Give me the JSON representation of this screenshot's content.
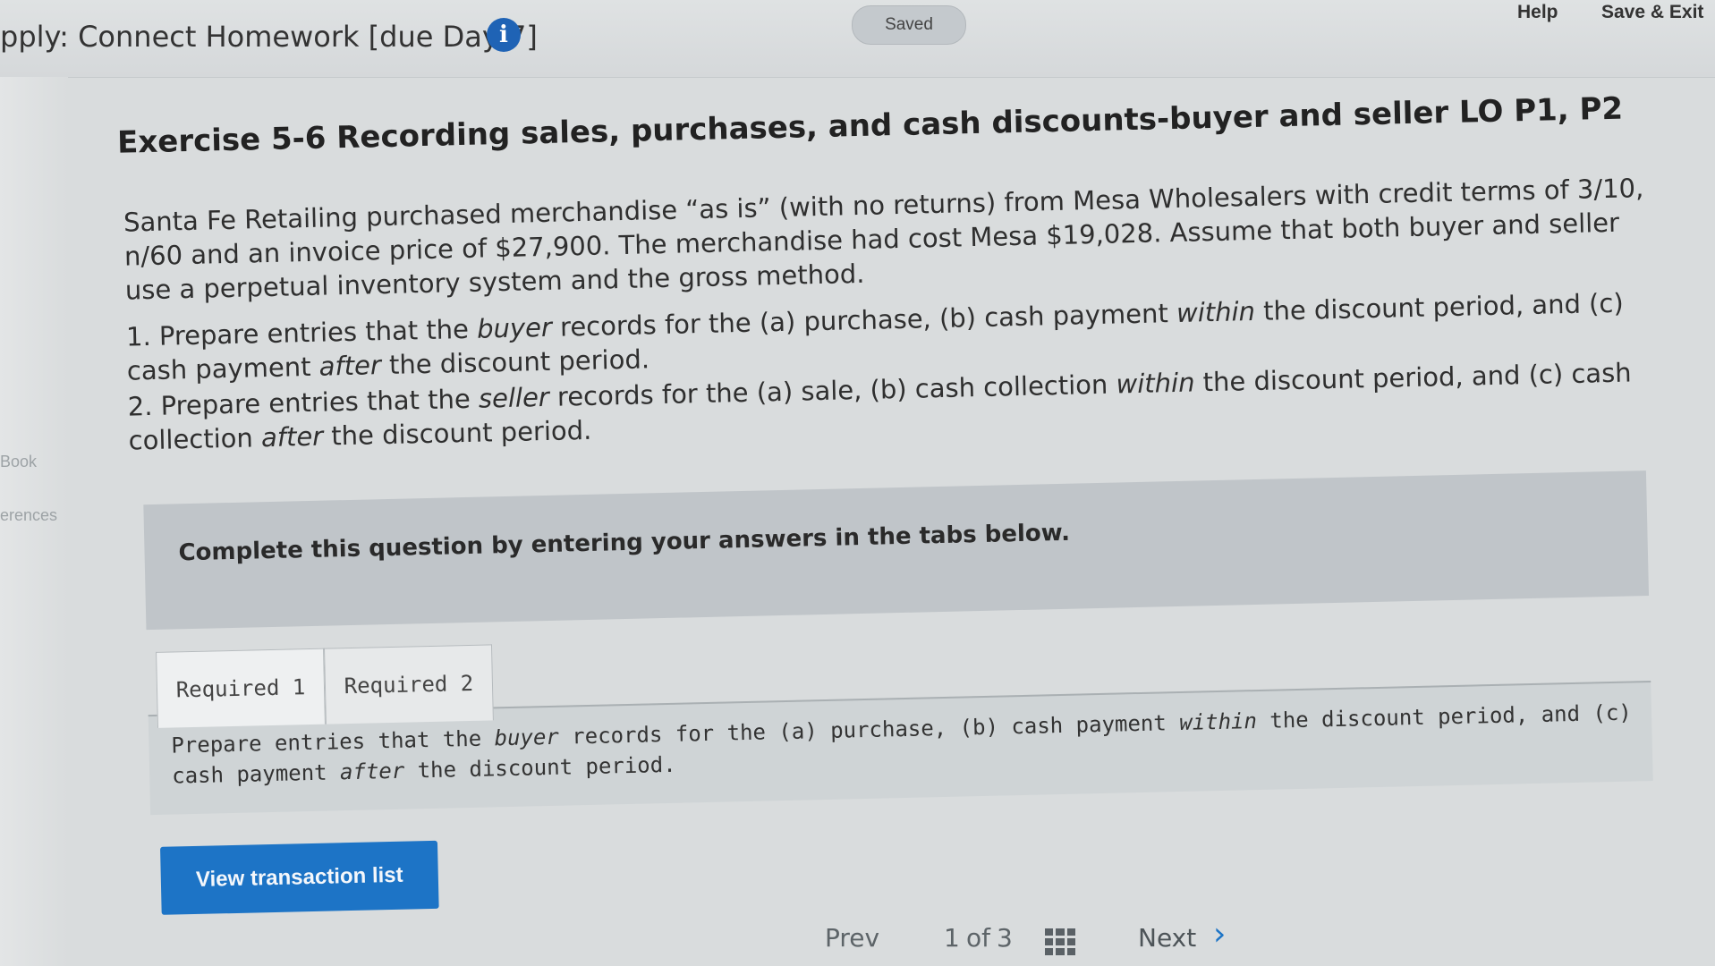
{
  "header": {
    "app_title": "pply: Connect Homework [due Day 7]",
    "info_icon": "i",
    "saved_label": "Saved",
    "help_label": "Help",
    "save_exit_label": "Save & Exit"
  },
  "side": {
    "item1": "Book",
    "item2": "erences"
  },
  "exercise": {
    "title": "Exercise 5-6 Recording sales, purchases, and cash discounts-buyer and seller LO P1, P2",
    "intro": "Santa Fe Retailing purchased merchandise “as is” (with no returns) from Mesa Wholesalers with credit terms of 3/10, n/60 and an invoice price of $27,900. The merchandise had cost Mesa $19,028. Assume that both buyer and seller use a perpetual inventory system and the gross method.",
    "req1_a": "1. Prepare entries that the ",
    "req1_em1": "buyer",
    "req1_b": " records for the (a) purchase, (b) cash payment ",
    "req1_em2": "within",
    "req1_c": " the discount period, and (c) cash payment ",
    "req1_em3": "after",
    "req1_d": " the discount period.",
    "req2_a": "2. Prepare entries that the ",
    "req2_em1": "seller",
    "req2_b": " records for the (a) sale, (b) cash collection ",
    "req2_em2": "within",
    "req2_c": " the discount period, and (c) cash collection ",
    "req2_em3": "after",
    "req2_d": " the discount period."
  },
  "instructions": "Complete this question by entering your answers in the tabs below.",
  "tabs": [
    {
      "label": "Required 1"
    },
    {
      "label": "Required 2"
    }
  ],
  "panel": {
    "text_a": "Prepare entries that the ",
    "text_em1": "buyer",
    "text_b": " records for the (a) purchase, (b) cash payment ",
    "text_em2": "within",
    "text_c": " the discount period, and (c) cash payment ",
    "text_em3": "after",
    "text_d": " the discount period."
  },
  "view_button": "View transaction list",
  "pager": {
    "prev": "Prev",
    "current": "1",
    "of": "of",
    "total": "3",
    "next": "Next",
    "next_chevron": "›"
  }
}
